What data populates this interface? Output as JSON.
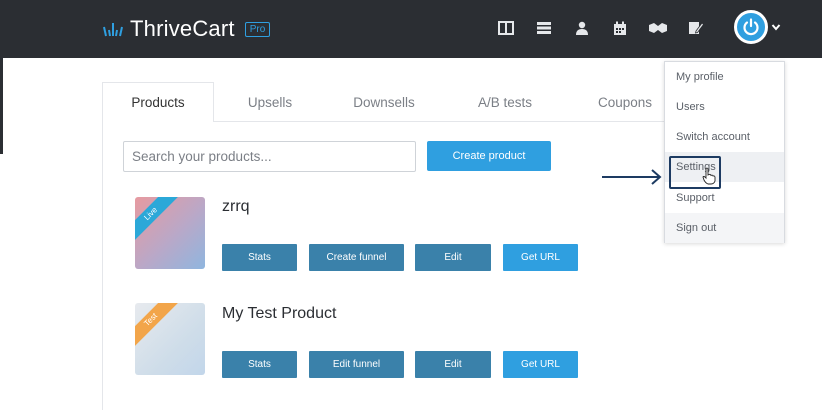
{
  "header": {
    "logo_text": "ThriveCart",
    "badge": "Pro",
    "nav_icons": [
      "dashboard-icon",
      "products-icon",
      "affiliates-icon",
      "calendar-icon",
      "partners-icon",
      "files-icon"
    ],
    "accent": "#2f9fe0",
    "bg": "#2b2e33"
  },
  "tabs": [
    "Products",
    "Upsells",
    "Downsells",
    "A/B tests",
    "Coupons"
  ],
  "search": {
    "placeholder": "Search your products..."
  },
  "create_button": "Create product",
  "products": [
    {
      "name": "zrrq",
      "status": "Live",
      "buttons": [
        "Stats",
        "Create funnel",
        "Edit",
        "Get URL"
      ]
    },
    {
      "name": "My Test Product",
      "status": "Test",
      "buttons": [
        "Stats",
        "Edit funnel",
        "Edit",
        "Get URL"
      ]
    }
  ],
  "dropdown": {
    "items": [
      "My profile",
      "Users",
      "Switch account",
      "Settings",
      "Support",
      "Sign out"
    ]
  }
}
